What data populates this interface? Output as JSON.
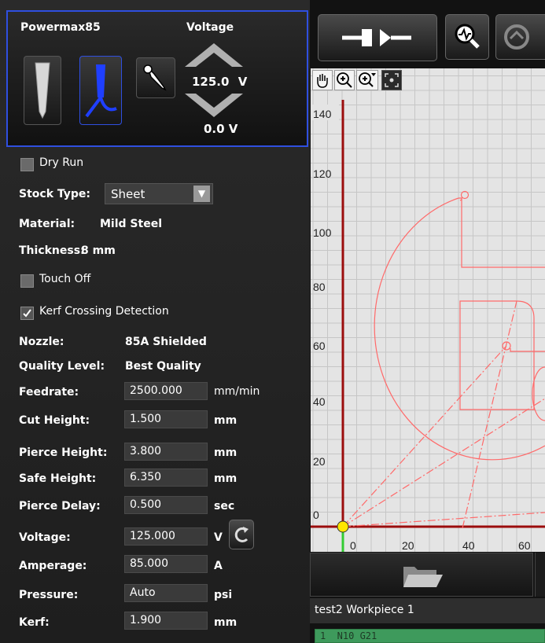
{
  "torch": {
    "name": "Powermax85",
    "voltage_title": "Voltage",
    "voltage_set": "125.0",
    "voltage_set_unit": "V",
    "voltage_actual": "0.0 V"
  },
  "settings": {
    "dry_run": "Dry Run",
    "stock_type_label": "Stock Type:",
    "stock_type_value": "Sheet",
    "material_label": "Material:",
    "material_value": "Mild Steel",
    "thickness_label": "Thickness:",
    "thickness_value": "8 mm",
    "touch_off": "Touch Off",
    "kerf_detection": "Kerf Crossing Detection",
    "nozzle_label": "Nozzle:",
    "nozzle_value": "85A Shielded",
    "quality_label": "Quality Level:",
    "quality_value": "Best Quality",
    "fields": [
      {
        "label": "Feedrate:",
        "value": "2500.000",
        "unit": "mm/min"
      },
      {
        "label": "Cut Height:",
        "value": "1.500",
        "unit": "mm"
      },
      {
        "label": "Pierce Height:",
        "value": "3.800",
        "unit": "mm"
      },
      {
        "label": "Safe Height:",
        "value": "6.350",
        "unit": "mm"
      },
      {
        "label": "Pierce Delay:",
        "value": "0.500",
        "unit": "sec"
      },
      {
        "label": "Voltage:",
        "value": "125.000",
        "unit": "V"
      },
      {
        "label": "Amperage:",
        "value": "85.000",
        "unit": "A"
      },
      {
        "label": "Pressure:",
        "value": "Auto",
        "unit": "psi"
      },
      {
        "label": "Kerf:",
        "value": "1.900",
        "unit": "mm"
      }
    ]
  },
  "plot": {
    "y_ticks": [
      "140",
      "120",
      "100",
      "80",
      "60",
      "40",
      "20",
      "0"
    ],
    "x_ticks": [
      "0",
      "20",
      "40",
      "60"
    ]
  },
  "program": {
    "workpiece": "test2 Workpiece 1",
    "code_line": "1  N10 G21"
  },
  "colors": {
    "accent": "#2f4fe0",
    "axis": "#9b0d0d",
    "path": "#ff6a6a",
    "code_bg": "#3e9a5c"
  }
}
